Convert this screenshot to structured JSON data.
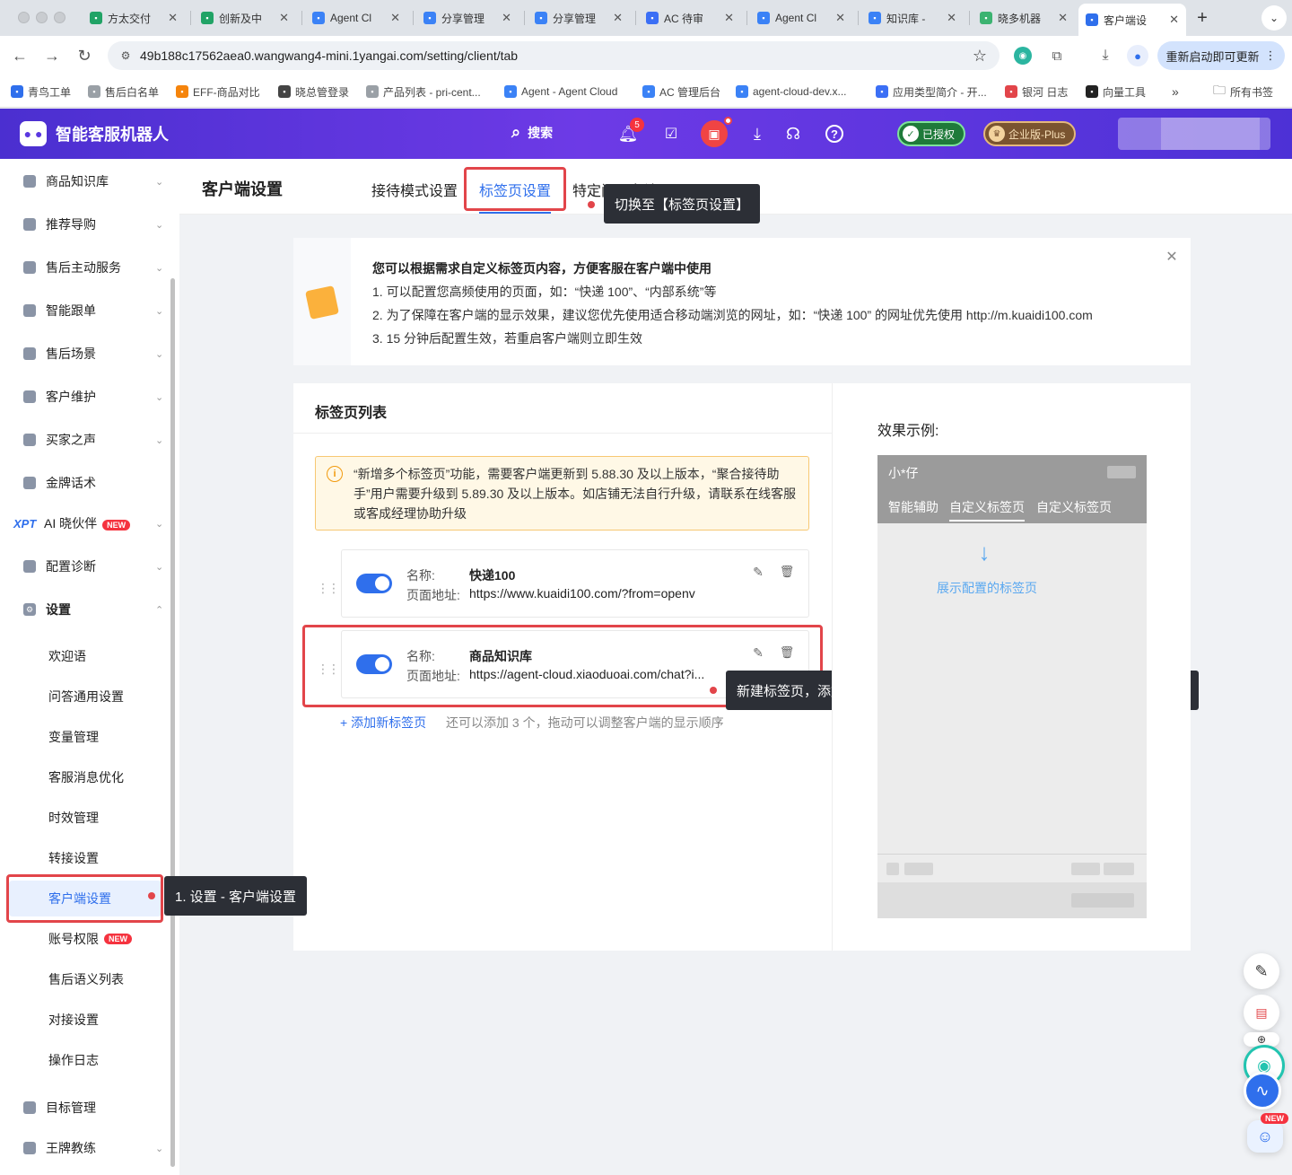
{
  "browser": {
    "tabs": [
      {
        "label": "方太交付",
        "icon": "sheet-green-icon",
        "color": "#21a366"
      },
      {
        "label": "创新及中",
        "icon": "sheet-green-icon",
        "color": "#21a366"
      },
      {
        "label": "Agent Cl",
        "icon": "agent-logo-icon",
        "color": "#3b82f6"
      },
      {
        "label": "分享管理",
        "icon": "agent-logo-icon",
        "color": "#3b82f6"
      },
      {
        "label": "分享管理",
        "icon": "agent-logo-icon",
        "color": "#3b82f6"
      },
      {
        "label": "AC 待审",
        "icon": "doc-blue-icon",
        "color": "#3b6ff5"
      },
      {
        "label": "Agent Cl",
        "icon": "agent-logo-icon",
        "color": "#3b82f6"
      },
      {
        "label": "知识库 -",
        "icon": "agent-logo-icon",
        "color": "#3b82f6"
      },
      {
        "label": "晓多机器",
        "icon": "flag-green-icon",
        "color": "#3cb371"
      },
      {
        "label": "客户端设",
        "icon": "robot-icon",
        "color": "#2f6fec"
      }
    ],
    "url": "49b188c17562aea0.wangwang4-mini.1yangai.com/setting/client/tab",
    "update_label": "重新启动即可更新",
    "bookmarks": [
      {
        "label": "青鸟工单",
        "color": "#2f6fec"
      },
      {
        "label": "售后白名单",
        "color": "#9aa0a6"
      },
      {
        "label": "EFF-商品对比",
        "color": "#f5840c"
      },
      {
        "label": "晓总管登录",
        "color": "#444444"
      },
      {
        "label": "产品列表 - pri-cent...",
        "color": "#9aa0a6"
      },
      {
        "label": "Agent - Agent Cloud",
        "color": "#3b82f6"
      },
      {
        "label": "AC 管理后台",
        "color": "#3b82f6"
      },
      {
        "label": "agent-cloud-dev.x...",
        "color": "#3b82f6"
      },
      {
        "label": "应用类型简介 - 开...",
        "color": "#3b6ff5"
      },
      {
        "label": "银河 日志",
        "color": "#e2454a"
      },
      {
        "label": "向量工具",
        "color": "#222222"
      }
    ],
    "more": "»",
    "all_bookmarks": "所有书签"
  },
  "header": {
    "brand": "智能客服机器人",
    "search": "搜索",
    "notif_count": "5",
    "authorized": "已授权",
    "edition": "企业版-Plus"
  },
  "sidebar": {
    "items": [
      {
        "label": "商品知识库",
        "icon": "box-icon",
        "chev": "⌄"
      },
      {
        "label": "推荐导购",
        "icon": "guide-icon",
        "chev": "⌄"
      },
      {
        "label": "售后主动服务",
        "icon": "service-icon",
        "chev": "⌄"
      },
      {
        "label": "智能跟单",
        "icon": "track-icon",
        "chev": "⌄"
      },
      {
        "label": "售后场景",
        "icon": "scene-icon",
        "chev": "⌄"
      },
      {
        "label": "客户维护",
        "icon": "customer-icon",
        "chev": "⌄"
      },
      {
        "label": "买家之声",
        "icon": "voice-icon",
        "chev": "⌄"
      },
      {
        "label": "金牌话术",
        "icon": "medal-icon",
        "chev": ""
      },
      {
        "label": "AI 晓伙伴",
        "icon": "xpt-icon",
        "chev": "⌄",
        "prefix": "XPT",
        "badge": "NEW"
      },
      {
        "label": "配置诊断",
        "icon": "diagnose-icon",
        "chev": "⌄"
      },
      {
        "label": "设置",
        "icon": "gear-icon",
        "chev": "⌃"
      }
    ],
    "settings_sub": [
      "欢迎语",
      "问答通用设置",
      "变量管理",
      "客服消息优化",
      "时效管理",
      "转接设置",
      "客户端设置",
      "账号权限",
      "售后语义列表",
      "对接设置",
      "操作日志"
    ],
    "sub_badge": "NEW",
    "bottom": [
      {
        "label": "目标管理",
        "icon": "target-icon",
        "chev": ""
      },
      {
        "label": "王牌教练",
        "icon": "coach-icon",
        "chev": "⌄"
      }
    ]
  },
  "page": {
    "title": "客户端设置",
    "tabs": [
      "接待模式设置",
      "标签页设置",
      "特定问题备注"
    ]
  },
  "notice": {
    "title": "您可以根据需求自定义标签页内容，方便客服在客户端中使用",
    "lines": [
      "1. 可以配置您高频使用的页面，如：“快递 100”、“内部系统”等",
      "2. 为了保障在客户端的显示效果，建议您优先使用适合移动端浏览的网址，如：“快递 100” 的网址优先使用 http://m.kuaidi100.com",
      "3. 15 分钟后配置生效，若重启客户端则立即生效"
    ]
  },
  "tab_list": {
    "title": "标签页列表",
    "warning": "“新增多个标签页”功能，需要客户端更新到 5.88.30 及以上版本，“聚合接待助手”用户需要升级到 5.89.30 及以上版本。如店铺无法自行升级，请联系在线客服或客成经理协助升级",
    "name_label": "名称:",
    "url_label": "页面地址:",
    "items": [
      {
        "name": "快递100",
        "url": "https://www.kuaidi100.com/?from=openv",
        "enabled": true
      },
      {
        "name": "商品知识库",
        "url": "https://agent-cloud.xiaoduoai.com/chat?i...",
        "enabled": true
      }
    ],
    "add_label": "+ 添加新标签页",
    "add_hint": "还可以添加 3 个，拖动可以调整客户端的显示顺序"
  },
  "preview": {
    "title": "效果示例:",
    "user": "小*仔",
    "tabs": [
      "智能辅助",
      "自定义标签页",
      "自定义标签页"
    ],
    "hint": "展示配置的标签页"
  },
  "annotations": {
    "switch_tab": "切换至【标签页设置】",
    "step1": "1. 设置 - 客户端设置",
    "new_tab": "新建标签页，添加Agentcloud分享链接后保存，开启后重启IPA助手即可使用"
  }
}
